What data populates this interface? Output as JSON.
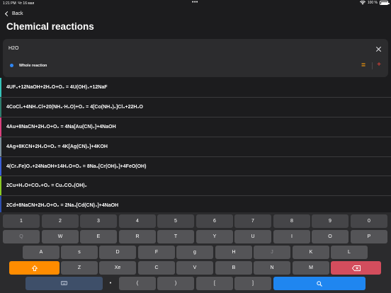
{
  "status_bar": {
    "time": "1:21 PM",
    "date": "Чт 16 мая",
    "battery": "100 %"
  },
  "nav": {
    "back_label": "Back",
    "title": "Chemical reactions"
  },
  "filter": {
    "query": "H2O",
    "mode": "Whole reaction",
    "mode_color": "#2f87f5"
  },
  "reactions": [
    {
      "text": "4UF₆+12NaOH+2H₂O+O₂ = 4U(OH)₄+12NaF",
      "color": "#36c4ba"
    },
    {
      "text": "4CoCl₂+4NH₄Cl+20(NH₃·H₂O)+O₂ = 4[Co(NH₃)₆]Cl₃+22H₂O",
      "color": "#2e7d6e"
    },
    {
      "text": "4Au+8NaCN+2H₂O+O₂ = 4Na[Au(CN)₂]+4NaOH",
      "color": "#d9407c"
    },
    {
      "text": "4Ag+8KCN+2H₂O+O₂ = 4K[Ag(CN)₂]+4KOH",
      "color": "#7a8f9a"
    },
    {
      "text": "4(Cr₂Fe)O₄+24NaOH+14H₂O+O₂ = 8Na₃[Cr(OH)₆]+4FeO(OH)",
      "color": "#3a5fd8"
    },
    {
      "text": "2Cu+H₂O+CO₂+O₂ = Cu₂CO₃(OH)₂",
      "color": "#8ac926"
    },
    {
      "text": "2Cd+8NaCN+2H₂O+O₂ = 2Na₃[Cd(CN)₄]+4NaOH",
      "color": "#2e4fb0"
    }
  ],
  "keyboard": {
    "row_num": [
      "1",
      "2",
      "3",
      "4",
      "5",
      "6",
      "7",
      "8",
      "9",
      "0"
    ],
    "row1": [
      "Q",
      "W",
      "E",
      "R",
      "T",
      "Y",
      "U",
      "I",
      "O",
      "P"
    ],
    "row2": [
      "A",
      "s",
      "D",
      "F",
      "g",
      "H",
      "J",
      "K",
      "L"
    ],
    "row3": [
      "Z",
      "Xe",
      "C",
      "V",
      "B",
      "N",
      "M"
    ],
    "row4": [
      "•",
      "(",
      ")",
      "[",
      "]"
    ]
  }
}
